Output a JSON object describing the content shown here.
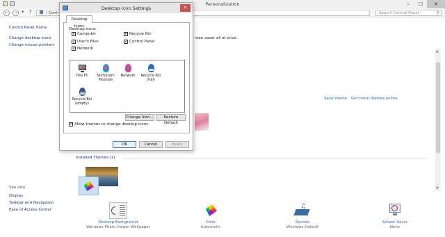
{
  "window": {
    "title": "Personalization",
    "address_text": "Contro",
    "search_placeholder": "Search Control Panel"
  },
  "left_pane": {
    "home": "Control Panel Home",
    "links": [
      "Change desktop icons",
      "Change mouse pointers"
    ],
    "see_also_label": "See also",
    "see_also": [
      "Display",
      "Taskbar and Navigation",
      "Ease of Access Center"
    ]
  },
  "main": {
    "hint_text": "reen saver all at once.",
    "save_theme": "Save theme",
    "get_more_themes": "Get more themes online",
    "installed_themes": "Installed Themes (1)"
  },
  "bottom": [
    {
      "label": "Desktop Background",
      "sub": "Windows Photo Viewer Wallpaper",
      "icon": "wallpaper-icon"
    },
    {
      "label": "Color",
      "sub": "Automatic",
      "icon": "color-icon"
    },
    {
      "label": "Sounds",
      "sub": "Windows Default",
      "icon": "sounds-icon"
    },
    {
      "label": "Screen Saver",
      "sub": "None",
      "icon": "screen-saver-icon"
    }
  ],
  "dialog": {
    "title": "Desktop Icon Settings",
    "tab": "Desktop Icons",
    "group_label": "Desktop icons",
    "checkboxes": [
      {
        "label": "Computer",
        "checked": true
      },
      {
        "label": "Recycle Bin",
        "checked": true
      },
      {
        "label": "User's Files",
        "checked": true
      },
      {
        "label": "Control Panel",
        "checked": true
      },
      {
        "label": "Network",
        "checked": true
      }
    ],
    "icons": [
      {
        "label": "This PC",
        "icon": "this-pc-icon"
      },
      {
        "label": "Norhazam Mustafa",
        "icon": "user-files-icon"
      },
      {
        "label": "Network",
        "icon": "network-icon"
      },
      {
        "label": "Recycle Bin (full)",
        "icon": "recycle-bin-full-icon"
      },
      {
        "label": "Recycle Bin (empty)",
        "icon": "recycle-bin-empty-icon"
      }
    ],
    "change_icon": "Change Icon...",
    "restore_default": "Restore Default",
    "allow_themes": "Allow themes to change desktop icons",
    "allow_themes_checked": true,
    "ok": "OK",
    "cancel": "Cancel",
    "apply": "Apply"
  }
}
